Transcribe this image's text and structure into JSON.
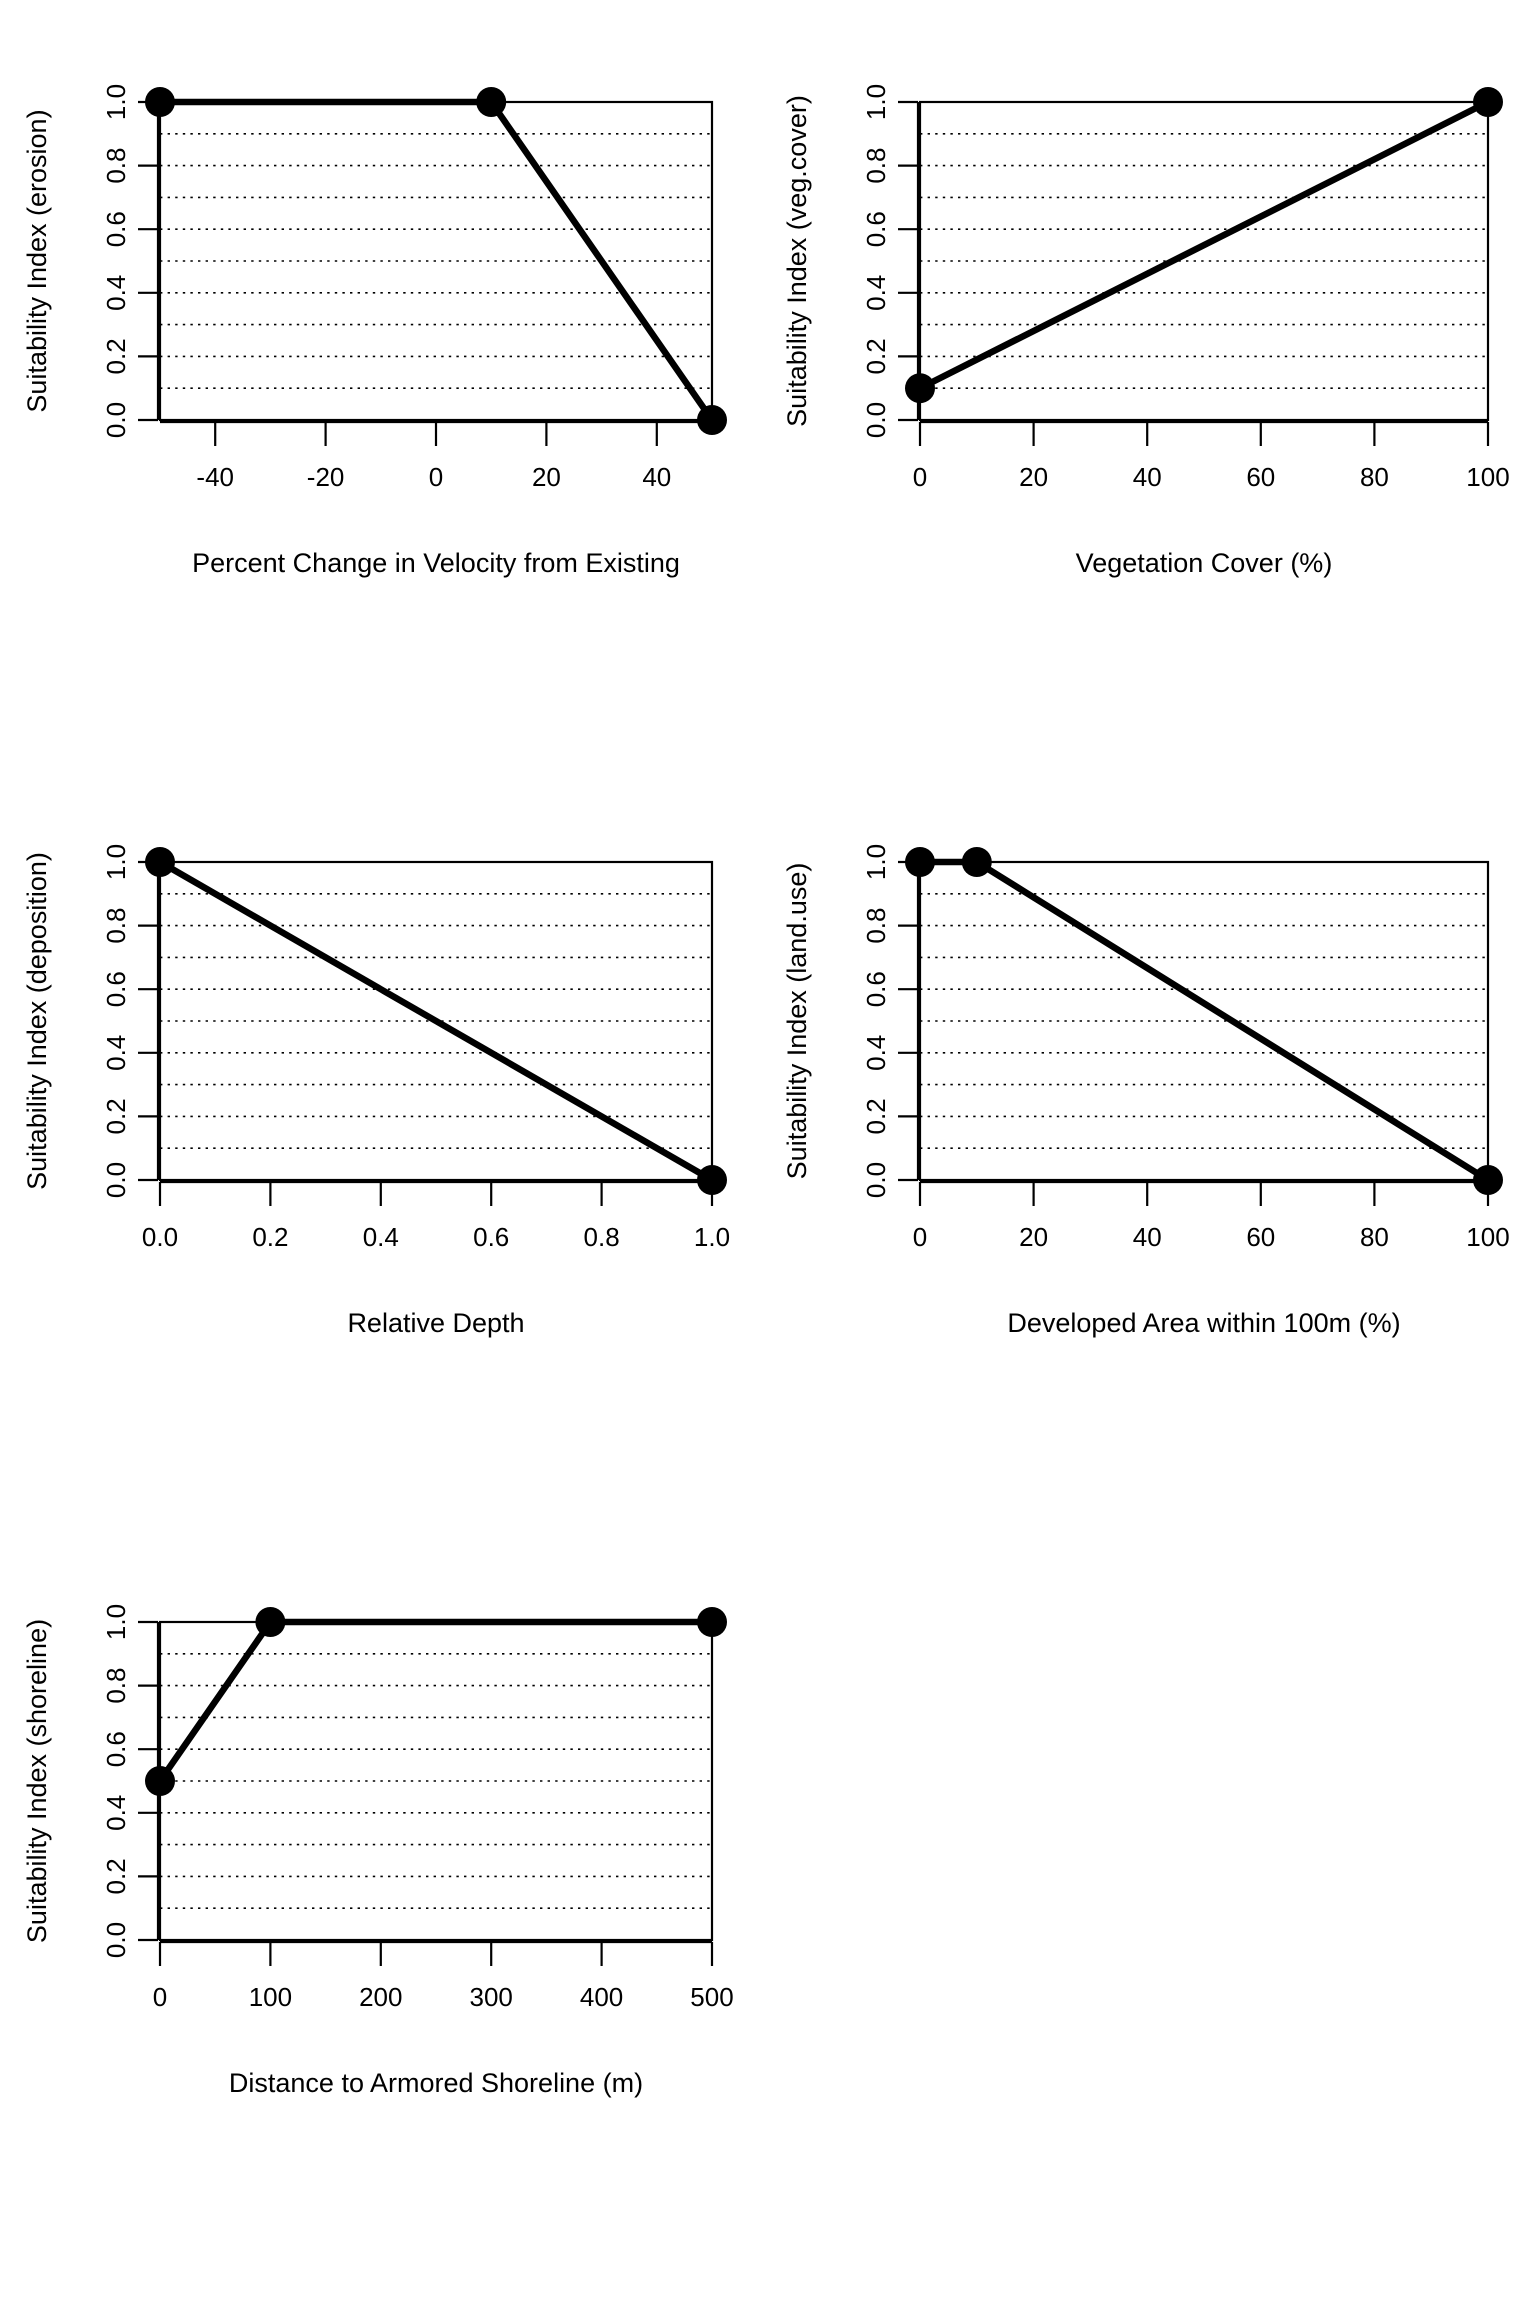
{
  "figure": {
    "kind": "multi-panel-suitability-index-curves",
    "panel_count": 5,
    "columns": 2,
    "rows": 3,
    "line_color": "#000000",
    "point_color": "#000000",
    "gridline_color": "#000000",
    "background_color": "#ffffff"
  },
  "chart_data": [
    {
      "type": "line",
      "id": "erosion",
      "title": "",
      "xlabel": "Percent Change in Velocity from Existing",
      "ylabel": "Suitability Index (erosion)",
      "x": [
        -50,
        10,
        50
      ],
      "values": [
        1.0,
        1.0,
        0.0
      ],
      "xlim": [
        -50,
        50
      ],
      "ylim": [
        0.0,
        1.0
      ],
      "xticks": [
        -40,
        -20,
        0,
        20,
        40
      ],
      "xticklabels": [
        "-40",
        "-20",
        "0",
        "20",
        "40"
      ],
      "yticks": [
        0.0,
        0.2,
        0.4,
        0.6,
        0.8,
        1.0
      ],
      "yticklabels": [
        "0.0",
        "0.2",
        "0.4",
        "0.6",
        "0.8",
        "1.0"
      ],
      "gridlines_y": [
        0.0,
        0.1,
        0.2,
        0.3,
        0.4,
        0.5,
        0.6,
        0.7,
        0.8,
        0.9,
        1.0
      ],
      "grid": "horizontal-dotted",
      "markers": "filled-circle",
      "legend": "none"
    },
    {
      "type": "line",
      "id": "veg.cover",
      "title": "",
      "xlabel": "Vegetation Cover (%)",
      "ylabel": "Suitability Index (veg.cover)",
      "x": [
        0,
        100
      ],
      "values": [
        0.1,
        1.0
      ],
      "xlim": [
        0,
        100
      ],
      "ylim": [
        0.0,
        1.0
      ],
      "xticks": [
        0,
        20,
        40,
        60,
        80,
        100
      ],
      "xticklabels": [
        "0",
        "20",
        "40",
        "60",
        "80",
        "100"
      ],
      "yticks": [
        0.0,
        0.2,
        0.4,
        0.6,
        0.8,
        1.0
      ],
      "yticklabels": [
        "0.0",
        "0.2",
        "0.4",
        "0.6",
        "0.8",
        "1.0"
      ],
      "gridlines_y": [
        0.0,
        0.1,
        0.2,
        0.3,
        0.4,
        0.5,
        0.6,
        0.7,
        0.8,
        0.9,
        1.0
      ],
      "grid": "horizontal-dotted",
      "markers": "filled-circle",
      "legend": "none"
    },
    {
      "type": "line",
      "id": "deposition",
      "title": "",
      "xlabel": "Relative Depth",
      "ylabel": "Suitability Index (deposition)",
      "x": [
        0.0,
        1.0
      ],
      "values": [
        1.0,
        0.0
      ],
      "xlim": [
        0.0,
        1.0
      ],
      "ylim": [
        0.0,
        1.0
      ],
      "xticks": [
        0.0,
        0.2,
        0.4,
        0.6,
        0.8,
        1.0
      ],
      "xticklabels": [
        "0.0",
        "0.2",
        "0.4",
        "0.6",
        "0.8",
        "1.0"
      ],
      "yticks": [
        0.0,
        0.2,
        0.4,
        0.6,
        0.8,
        1.0
      ],
      "yticklabels": [
        "0.0",
        "0.2",
        "0.4",
        "0.6",
        "0.8",
        "1.0"
      ],
      "gridlines_y": [
        0.0,
        0.1,
        0.2,
        0.3,
        0.4,
        0.5,
        0.6,
        0.7,
        0.8,
        0.9,
        1.0
      ],
      "grid": "horizontal-dotted",
      "markers": "filled-circle",
      "legend": "none"
    },
    {
      "type": "line",
      "id": "land.use",
      "title": "",
      "xlabel": "Developed Area within 100m (%)",
      "ylabel": "Suitability Index (land.use)",
      "x": [
        0,
        10,
        100
      ],
      "values": [
        1.0,
        1.0,
        0.0
      ],
      "xlim": [
        0,
        100
      ],
      "ylim": [
        0.0,
        1.0
      ],
      "xticks": [
        0,
        20,
        40,
        60,
        80,
        100
      ],
      "xticklabels": [
        "0",
        "20",
        "40",
        "60",
        "80",
        "100"
      ],
      "yticks": [
        0.0,
        0.2,
        0.4,
        0.6,
        0.8,
        1.0
      ],
      "yticklabels": [
        "0.0",
        "0.2",
        "0.4",
        "0.6",
        "0.8",
        "1.0"
      ],
      "gridlines_y": [
        0.0,
        0.1,
        0.2,
        0.3,
        0.4,
        0.5,
        0.6,
        0.7,
        0.8,
        0.9,
        1.0
      ],
      "grid": "horizontal-dotted",
      "markers": "filled-circle",
      "legend": "none"
    },
    {
      "type": "line",
      "id": "shoreline",
      "title": "",
      "xlabel": "Distance to Armored Shoreline (m)",
      "ylabel": "Suitability Index (shoreline)",
      "x": [
        0,
        100,
        500
      ],
      "values": [
        0.5,
        1.0,
        1.0
      ],
      "xlim": [
        0,
        500
      ],
      "ylim": [
        0.0,
        1.0
      ],
      "xticks": [
        0,
        100,
        200,
        300,
        400,
        500
      ],
      "xticklabels": [
        "0",
        "100",
        "200",
        "300",
        "400",
        "500"
      ],
      "yticks": [
        0.0,
        0.2,
        0.4,
        0.6,
        0.8,
        1.0
      ],
      "yticklabels": [
        "0.0",
        "0.2",
        "0.4",
        "0.6",
        "0.8",
        "1.0"
      ],
      "gridlines_y": [
        0.0,
        0.1,
        0.2,
        0.3,
        0.4,
        0.5,
        0.6,
        0.7,
        0.8,
        0.9,
        1.0
      ],
      "grid": "horizontal-dotted",
      "markers": "filled-circle",
      "legend": "none"
    }
  ]
}
